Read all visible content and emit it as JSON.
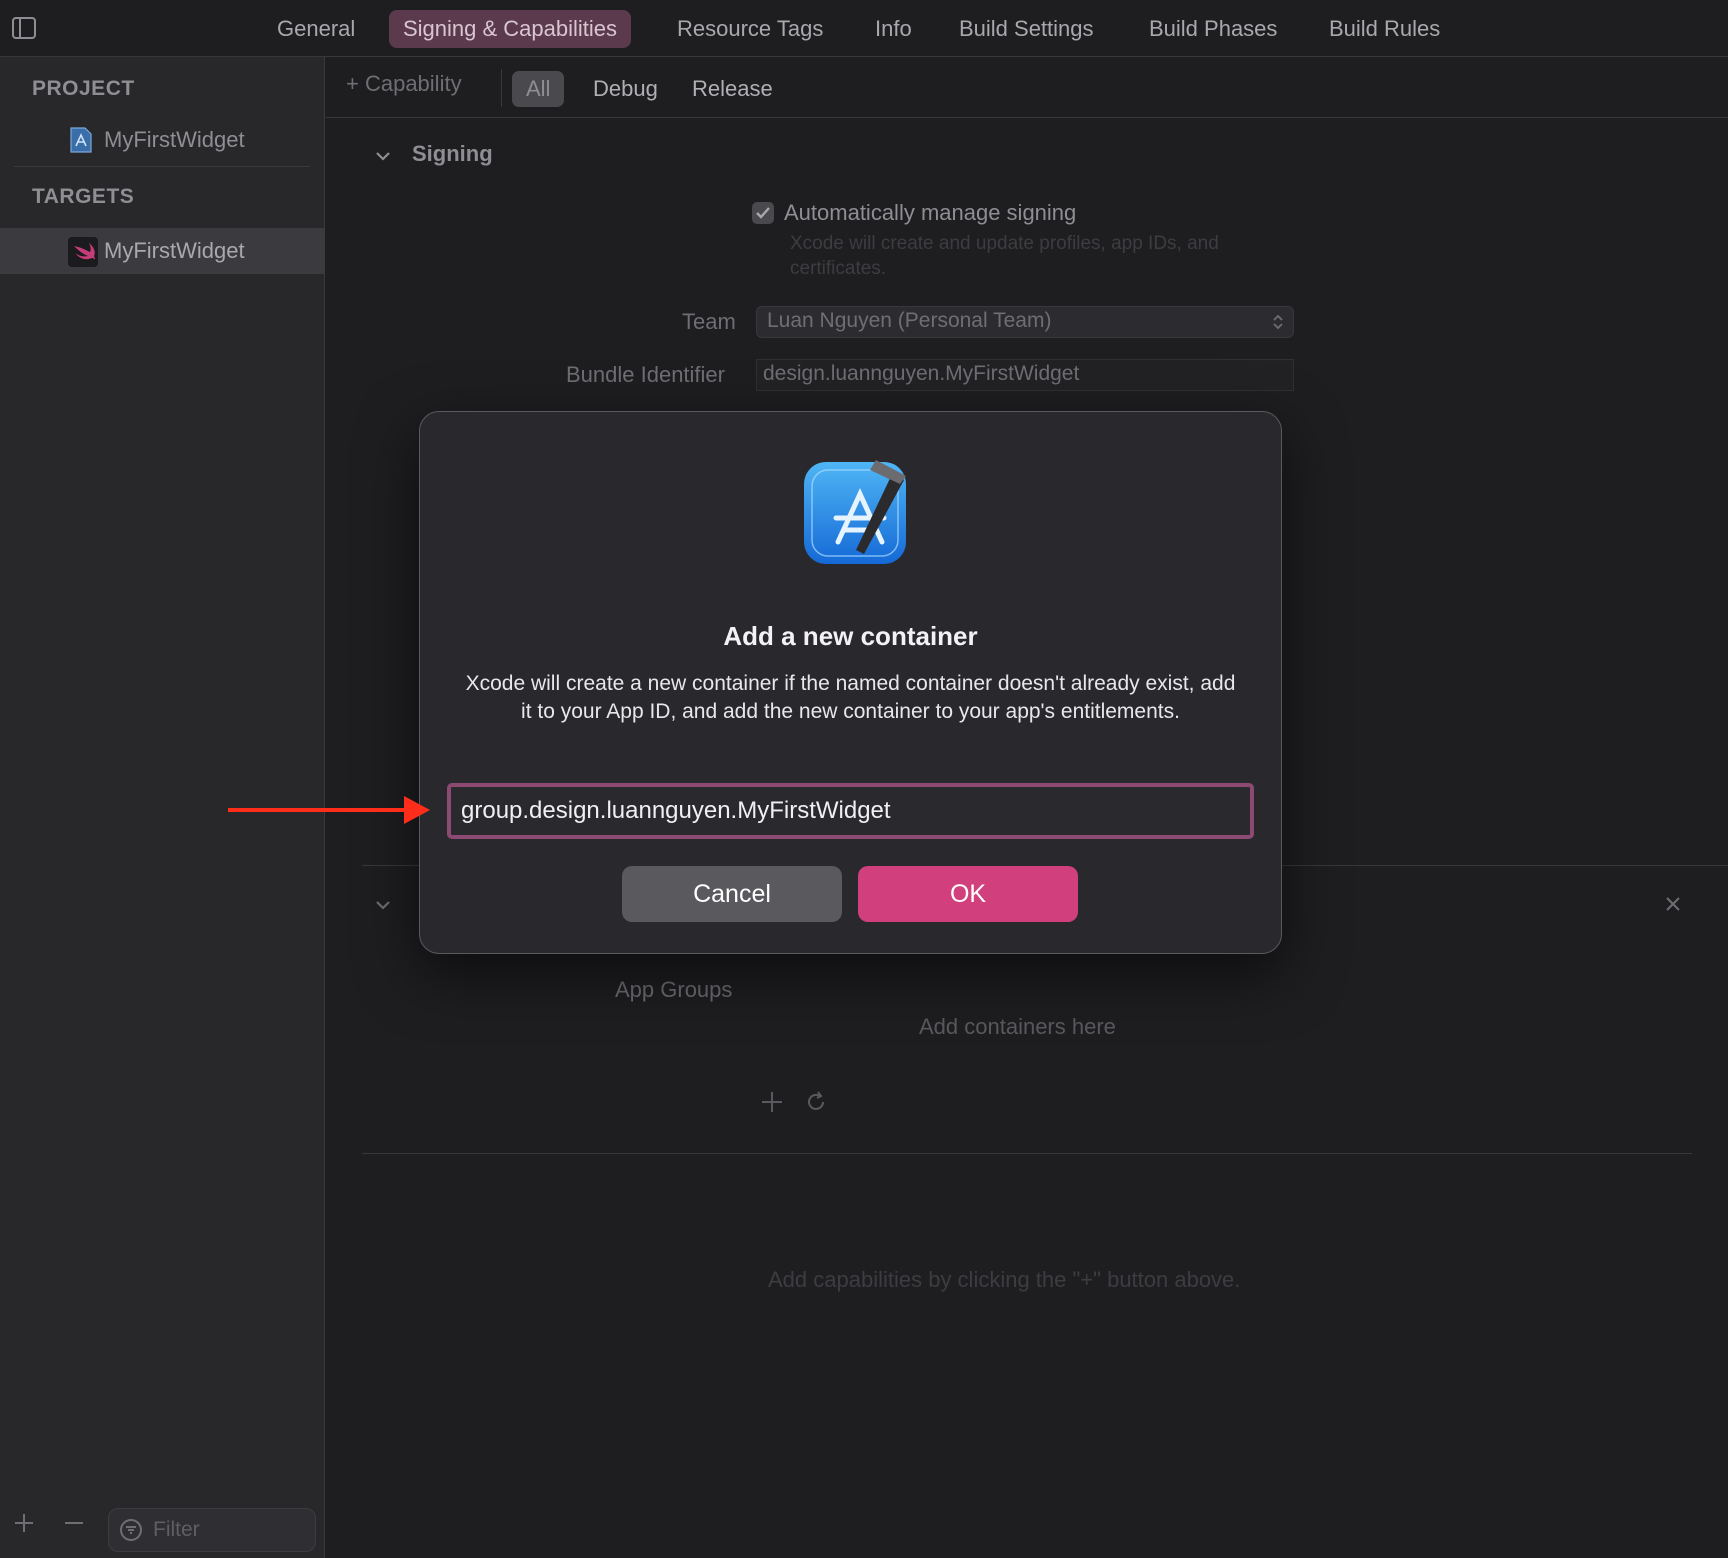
{
  "tabs": [
    {
      "label": "General",
      "active": false
    },
    {
      "label": "Signing & Capabilities",
      "active": true
    },
    {
      "label": "Resource Tags",
      "active": false
    },
    {
      "label": "Info",
      "active": false
    },
    {
      "label": "Build Settings",
      "active": false
    },
    {
      "label": "Build Phases",
      "active": false
    },
    {
      "label": "Build Rules",
      "active": false
    }
  ],
  "sidebar": {
    "project_header": "PROJECT",
    "project_item": "MyFirstWidget",
    "targets_header": "TARGETS",
    "target_item": "MyFirstWidget",
    "filter_placeholder": "Filter"
  },
  "subbar": {
    "capability_label": "+ Capability",
    "segments": [
      "All",
      "Debug",
      "Release"
    ],
    "selected_segment": "All"
  },
  "signing": {
    "section_title": "Signing",
    "auto_manage_label": "Automatically manage signing",
    "auto_manage_checked": true,
    "auto_manage_desc_line1": "Xcode will create and update profiles, app IDs, and",
    "auto_manage_desc_line2": "certificates.",
    "team_label": "Team",
    "team_value": "Luan Nguyen (Personal Team)",
    "bundle_label": "Bundle Identifier",
    "bundle_value": "design.luannguyen.MyFirstWidget"
  },
  "app_groups": {
    "label": "App Groups",
    "empty_text": "Add containers here"
  },
  "footer_hint": "Add capabilities by clicking the \"+\" button above.",
  "dialog": {
    "title": "Add a new container",
    "message": "Xcode will create a new container if the named container doesn't already exist, add it to your App ID, and add the new container to your app's entitlements.",
    "input_value": "group.design.luannguyen.MyFirstWidget",
    "cancel_label": "Cancel",
    "ok_label": "OK"
  },
  "colors": {
    "accent": "#d1407d",
    "annotation_arrow": "#ff2d1a"
  }
}
